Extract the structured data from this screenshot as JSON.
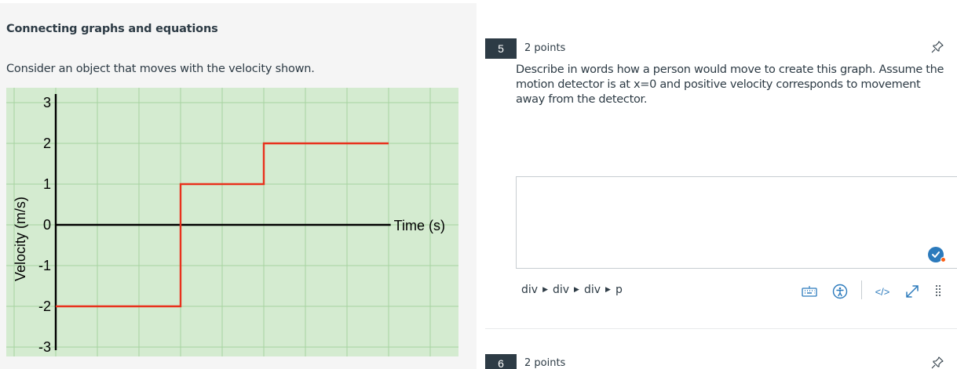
{
  "left": {
    "title": "Connecting graphs and equations",
    "prompt": "Consider an object that moves with the velocity shown."
  },
  "chart_data": {
    "type": "line",
    "title": "",
    "xlabel": "Time (s)",
    "ylabel": "Velocity (m/s)",
    "ylim": [
      -3,
      3
    ],
    "y_ticks": [
      "3",
      "2",
      "1",
      "0",
      "-1",
      "-2",
      "-3"
    ],
    "grid": true,
    "series": [
      {
        "color": "#e8311c",
        "x": [
          0,
          3,
          3,
          5,
          5,
          8
        ],
        "y": [
          -2,
          -2,
          1,
          1,
          2,
          2
        ]
      }
    ],
    "background": "#d4ebd0",
    "grid_color": "#a6d3a0"
  },
  "question5": {
    "number": "5",
    "points": "2 points",
    "text": "Describe in words how a person would move to create this graph. Assume the motion detector is at x=0 and positive velocity corresponds to movement away from the detector.",
    "answer": ""
  },
  "editor": {
    "breadcrumb": [
      "div",
      "div",
      "div",
      "p"
    ],
    "html_label": "</>",
    "icons": [
      "keyboard-icon",
      "accessibility-icon",
      "html-editor-icon",
      "expand-icon",
      "drag-handle-icon"
    ]
  },
  "question6": {
    "number": "6",
    "points": "2 points"
  },
  "colors": {
    "accent": "#2b7abc",
    "badge_dark": "#2d3b45",
    "notify": "#fc5e13"
  }
}
